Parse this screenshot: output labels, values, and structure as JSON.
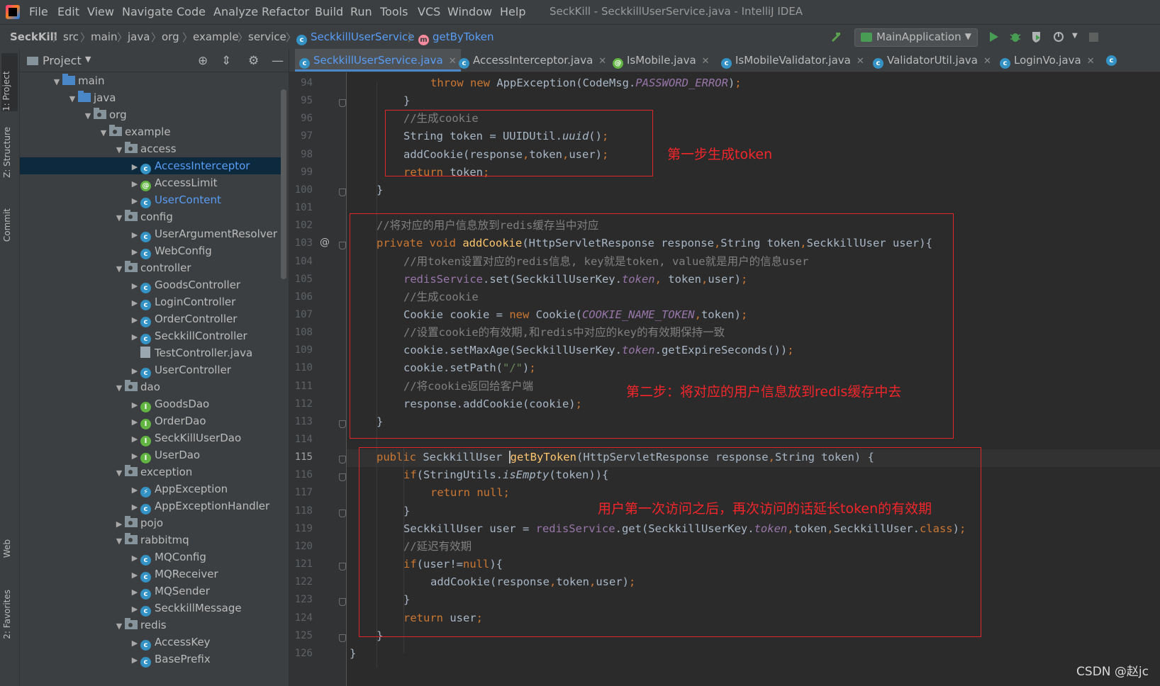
{
  "menubar": {
    "items": [
      "File",
      "Edit",
      "View",
      "Navigate",
      "Code",
      "Analyze",
      "Refactor",
      "Build",
      "Run",
      "Tools",
      "VCS",
      "Window",
      "Help"
    ],
    "window_title": "SeckKill - SeckkillUserService.java - IntelliJ IDEA"
  },
  "navbar": {
    "crumbs": [
      "SeckKill",
      "src",
      "main",
      "java",
      "org",
      "example",
      "service",
      "SeckkillUserService",
      "getByToken"
    ],
    "run_config": "MainApplication"
  },
  "toolstripe": {
    "tabs": [
      "1: Project",
      "Z: Structure",
      "Commit",
      "Web",
      "2: Favorites"
    ]
  },
  "project_panel": {
    "title": "Project",
    "tree": [
      {
        "label": "main",
        "kind": "folder-blue",
        "depth": 0,
        "open": true
      },
      {
        "label": "java",
        "kind": "folder-blue",
        "depth": 1,
        "open": true
      },
      {
        "label": "org",
        "kind": "package",
        "depth": 2,
        "open": true
      },
      {
        "label": "example",
        "kind": "package",
        "depth": 3,
        "open": true
      },
      {
        "label": "access",
        "kind": "package",
        "depth": 4,
        "open": true
      },
      {
        "label": "AccessInterceptor",
        "kind": "class",
        "depth": 5,
        "closed": true,
        "selected": true,
        "link": true
      },
      {
        "label": "AccessLimit",
        "kind": "annotation",
        "depth": 5,
        "closed": true
      },
      {
        "label": "UserContent",
        "kind": "class",
        "depth": 5,
        "closed": true,
        "link": true
      },
      {
        "label": "config",
        "kind": "package",
        "depth": 4,
        "open": true
      },
      {
        "label": "UserArgumentResolver",
        "kind": "class",
        "depth": 5,
        "closed": true
      },
      {
        "label": "WebConfig",
        "kind": "class",
        "depth": 5,
        "closed": true
      },
      {
        "label": "controller",
        "kind": "package",
        "depth": 4,
        "open": true
      },
      {
        "label": "GoodsController",
        "kind": "class",
        "depth": 5,
        "closed": true
      },
      {
        "label": "LoginController",
        "kind": "class",
        "depth": 5,
        "closed": true
      },
      {
        "label": "OrderController",
        "kind": "class",
        "depth": 5,
        "closed": true
      },
      {
        "label": "SeckkillController",
        "kind": "class",
        "depth": 5,
        "closed": true
      },
      {
        "label": "TestController.java",
        "kind": "javafile",
        "depth": 5
      },
      {
        "label": "UserController",
        "kind": "class",
        "depth": 5,
        "closed": true
      },
      {
        "label": "dao",
        "kind": "package",
        "depth": 4,
        "open": true
      },
      {
        "label": "GoodsDao",
        "kind": "interface",
        "depth": 5,
        "closed": true
      },
      {
        "label": "OrderDao",
        "kind": "interface",
        "depth": 5,
        "closed": true
      },
      {
        "label": "SeckKillUserDao",
        "kind": "interface",
        "depth": 5,
        "closed": true
      },
      {
        "label": "UserDao",
        "kind": "interface",
        "depth": 5,
        "closed": true
      },
      {
        "label": "exception",
        "kind": "package",
        "depth": 4,
        "open": true
      },
      {
        "label": "AppException",
        "kind": "exception",
        "depth": 5,
        "closed": true
      },
      {
        "label": "AppExceptionHandler",
        "kind": "class",
        "depth": 5,
        "closed": true
      },
      {
        "label": "pojo",
        "kind": "package",
        "depth": 4,
        "closed": true
      },
      {
        "label": "rabbitmq",
        "kind": "package",
        "depth": 4,
        "open": true
      },
      {
        "label": "MQConfig",
        "kind": "class",
        "depth": 5,
        "closed": true
      },
      {
        "label": "MQReceiver",
        "kind": "class",
        "depth": 5,
        "closed": true
      },
      {
        "label": "MQSender",
        "kind": "class",
        "depth": 5,
        "closed": true
      },
      {
        "label": "SeckkillMessage",
        "kind": "class",
        "depth": 5,
        "closed": true
      },
      {
        "label": "redis",
        "kind": "package",
        "depth": 4,
        "open": true
      },
      {
        "label": "AccessKey",
        "kind": "class",
        "depth": 5,
        "closed": true
      },
      {
        "label": "BasePrefix",
        "kind": "class",
        "depth": 5,
        "closed": true
      }
    ]
  },
  "editor_tabs": [
    {
      "label": "SeckkillUserService.java",
      "kind": "class",
      "active": true
    },
    {
      "label": "AccessInterceptor.java",
      "kind": "class"
    },
    {
      "label": "IsMobile.java",
      "kind": "annotation"
    },
    {
      "label": "IsMobileValidator.java",
      "kind": "class"
    },
    {
      "label": "ValidatorUtil.java",
      "kind": "class"
    },
    {
      "label": "LoginVo.java",
      "kind": "class"
    }
  ],
  "editor": {
    "current_line": 115,
    "lines": [
      {
        "n": 94,
        "indent": 3,
        "tokens": [
          [
            "kw",
            "throw "
          ],
          [
            "kw",
            "new "
          ],
          [
            "",
            "AppException(CodeMsg."
          ],
          [
            "st",
            "PASSWORD_ERROR"
          ],
          [
            "",
            ")"
          ],
          [
            "kw",
            ";"
          ]
        ]
      },
      {
        "n": 95,
        "indent": 2,
        "tokens": [
          [
            "",
            "}"
          ]
        ]
      },
      {
        "n": 96,
        "indent": 2,
        "tokens": [
          [
            "cm",
            "//生成cookie"
          ]
        ]
      },
      {
        "n": 97,
        "indent": 2,
        "tokens": [
          [
            "",
            "String token = UUIDUtil."
          ],
          [
            "it",
            "uuid"
          ],
          [
            "",
            "()"
          ],
          [
            "kw",
            ";"
          ]
        ]
      },
      {
        "n": 98,
        "indent": 2,
        "tokens": [
          [
            "",
            "addCookie(response"
          ],
          [
            "kw",
            ","
          ],
          [
            "",
            "token"
          ],
          [
            "kw",
            ","
          ],
          [
            "",
            "user)"
          ],
          [
            "kw",
            ";"
          ]
        ]
      },
      {
        "n": 99,
        "indent": 2,
        "tokens": [
          [
            "kw",
            "return "
          ],
          [
            "",
            "token"
          ],
          [
            "kw",
            ";"
          ]
        ]
      },
      {
        "n": 100,
        "indent": 1,
        "tokens": [
          [
            "",
            "}"
          ]
        ]
      },
      {
        "n": 101,
        "indent": 0,
        "tokens": []
      },
      {
        "n": 102,
        "indent": 1,
        "tokens": [
          [
            "cm",
            "//将对应的用户信息放到redis缓存当中对应"
          ]
        ]
      },
      {
        "n": 103,
        "indent": 1,
        "tokens": [
          [
            "kw",
            "private void "
          ],
          [
            "fn",
            "addCookie"
          ],
          [
            "",
            "(HttpServletResponse response"
          ],
          [
            "kw",
            ","
          ],
          [
            "",
            "String token"
          ],
          [
            "kw",
            ","
          ],
          [
            "",
            "SeckkillUser user){"
          ]
        ]
      },
      {
        "n": 104,
        "indent": 2,
        "tokens": [
          [
            "cm",
            "//用token设置对应的redis信息, key就是token, value就是用户的信息user"
          ]
        ]
      },
      {
        "n": 105,
        "indent": 2,
        "tokens": [
          [
            "fld",
            "redisService"
          ],
          [
            "",
            ".set(SeckkillUserKey."
          ],
          [
            "st",
            "token"
          ],
          [
            "kw",
            ", "
          ],
          [
            "",
            "token"
          ],
          [
            "kw",
            ","
          ],
          [
            "",
            "user)"
          ],
          [
            "kw",
            ";"
          ]
        ]
      },
      {
        "n": 106,
        "indent": 2,
        "tokens": [
          [
            "cm",
            "//生成cookie"
          ]
        ]
      },
      {
        "n": 107,
        "indent": 2,
        "tokens": [
          [
            "",
            "Cookie cookie = "
          ],
          [
            "kw",
            "new "
          ],
          [
            "",
            "Cookie("
          ],
          [
            "st",
            "COOKIE_NAME_TOKEN"
          ],
          [
            "kw",
            ","
          ],
          [
            "",
            "token)"
          ],
          [
            "kw",
            ";"
          ]
        ]
      },
      {
        "n": 108,
        "indent": 2,
        "tokens": [
          [
            "cm",
            "//设置cookie的有效期,和redis中对应的key的有效期保持一致"
          ]
        ]
      },
      {
        "n": 109,
        "indent": 2,
        "tokens": [
          [
            "",
            "cookie.setMaxAge(SeckkillUserKey."
          ],
          [
            "st",
            "token"
          ],
          [
            "",
            ".getExpireSeconds())"
          ],
          [
            "kw",
            ";"
          ]
        ]
      },
      {
        "n": 110,
        "indent": 2,
        "tokens": [
          [
            "",
            "cookie.setPath("
          ],
          [
            "str",
            "\"/\""
          ],
          [
            "",
            ")"
          ],
          [
            "kw",
            ";"
          ]
        ]
      },
      {
        "n": 111,
        "indent": 2,
        "tokens": [
          [
            "cm",
            "//将cookie返回给客户端"
          ]
        ]
      },
      {
        "n": 112,
        "indent": 2,
        "tokens": [
          [
            "",
            "response.addCookie(cookie)"
          ],
          [
            "kw",
            ";"
          ]
        ]
      },
      {
        "n": 113,
        "indent": 1,
        "tokens": [
          [
            "",
            "}"
          ]
        ]
      },
      {
        "n": 114,
        "indent": 0,
        "tokens": []
      },
      {
        "n": 115,
        "indent": 1,
        "tokens": [
          [
            "kw",
            "public "
          ],
          [
            "",
            "SeckkillUser "
          ],
          [
            "caret",
            ""
          ],
          [
            "fn",
            "getByToken"
          ],
          [
            "",
            "(HttpServletResponse response"
          ],
          [
            "kw",
            ","
          ],
          [
            "",
            "String token) {"
          ]
        ]
      },
      {
        "n": 116,
        "indent": 2,
        "tokens": [
          [
            "kw",
            "if"
          ],
          [
            "",
            "(StringUtils."
          ],
          [
            "it",
            "isEmpty"
          ],
          [
            "",
            "(token)){"
          ]
        ]
      },
      {
        "n": 117,
        "indent": 3,
        "tokens": [
          [
            "kw",
            "return null;"
          ]
        ]
      },
      {
        "n": 118,
        "indent": 2,
        "tokens": [
          [
            "",
            "}"
          ]
        ]
      },
      {
        "n": 119,
        "indent": 2,
        "tokens": [
          [
            "",
            "SeckkillUser user = "
          ],
          [
            "fld",
            "redisService"
          ],
          [
            "",
            ".get(SeckkillUserKey."
          ],
          [
            "st",
            "token"
          ],
          [
            "kw",
            ","
          ],
          [
            "",
            "token"
          ],
          [
            "kw",
            ","
          ],
          [
            "",
            "SeckkillUser."
          ],
          [
            "kw",
            "class"
          ],
          [
            "",
            ")"
          ],
          [
            "kw",
            ";"
          ]
        ]
      },
      {
        "n": 120,
        "indent": 2,
        "tokens": [
          [
            "cm",
            "//延迟有效期"
          ]
        ]
      },
      {
        "n": 121,
        "indent": 2,
        "tokens": [
          [
            "kw",
            "if"
          ],
          [
            "",
            "(user!="
          ],
          [
            "kw",
            "null"
          ],
          [
            "",
            "){"
          ]
        ]
      },
      {
        "n": 122,
        "indent": 3,
        "tokens": [
          [
            "",
            "addCookie(response"
          ],
          [
            "kw",
            ","
          ],
          [
            "",
            "token"
          ],
          [
            "kw",
            ","
          ],
          [
            "",
            "user)"
          ],
          [
            "kw",
            ";"
          ]
        ]
      },
      {
        "n": 123,
        "indent": 2,
        "tokens": [
          [
            "",
            "}"
          ]
        ]
      },
      {
        "n": 124,
        "indent": 2,
        "tokens": [
          [
            "kw",
            "return "
          ],
          [
            "",
            "user"
          ],
          [
            "kw",
            ";"
          ]
        ]
      },
      {
        "n": 125,
        "indent": 1,
        "tokens": [
          [
            "",
            "}"
          ]
        ]
      },
      {
        "n": 126,
        "indent": 0,
        "tokens": [
          [
            "",
            "}"
          ]
        ]
      }
    ],
    "annotations": [
      {
        "text": "第一步生成token"
      },
      {
        "text": "第二步：将对应的用户信息放到redis缓存中去"
      },
      {
        "text": "用户第一次访问之后，再次访问的话延长token的有效期"
      }
    ]
  },
  "watermark": "CSDN @赵jc",
  "colors": {
    "bg_editor": "#2b2b2b",
    "bg_panel": "#3c3f41",
    "keyword": "#cc7832",
    "comment": "#808080",
    "method_decl": "#ffc66d",
    "static_field": "#9876aa",
    "plain": "#a9b7c6",
    "annotation_red": "#f2262b",
    "link": "#589df6"
  }
}
